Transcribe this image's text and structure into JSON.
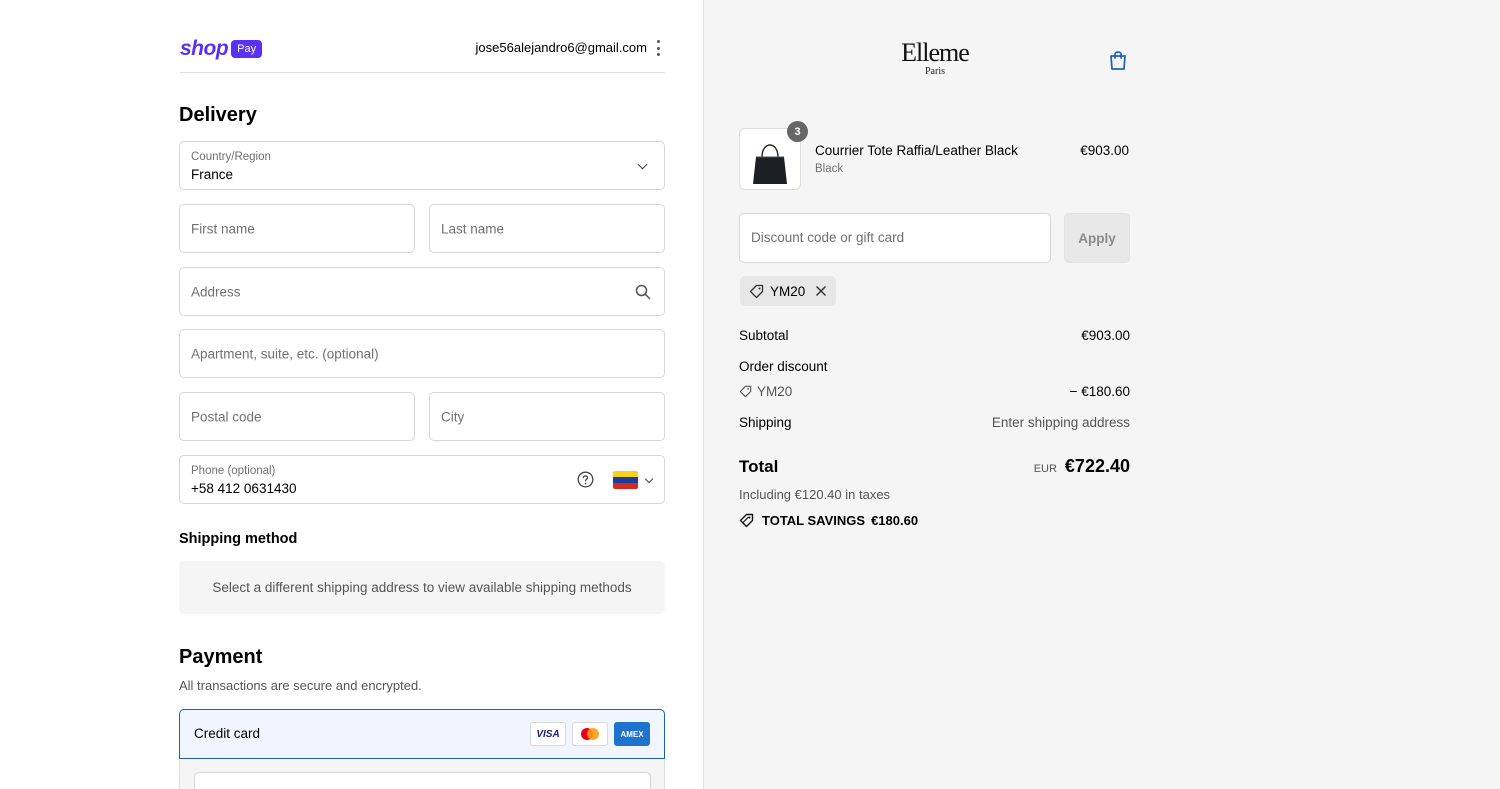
{
  "header": {
    "shop_word": "shop",
    "pay_badge": "Pay",
    "email": "jose56alejandro6@gmail.com"
  },
  "delivery": {
    "title": "Delivery",
    "country_label": "Country/Region",
    "country_value": "France",
    "first_name_placeholder": "First name",
    "last_name_placeholder": "Last name",
    "address_placeholder": "Address",
    "apartment_placeholder": "Apartment, suite, etc. (optional)",
    "postal_placeholder": "Postal code",
    "city_placeholder": "City",
    "phone_label": "Phone (optional)",
    "phone_value": "+58 412 0631430"
  },
  "shipping_method": {
    "title": "Shipping method",
    "message": "Select a different shipping address to view available shipping methods"
  },
  "payment": {
    "title": "Payment",
    "subtitle": "All transactions are secure and encrypted.",
    "credit_card_label": "Credit card",
    "cards": [
      "VISA",
      "mastercard",
      "AMEX"
    ]
  },
  "brand": {
    "name": "Elleme",
    "sub": "Paris"
  },
  "order": {
    "item": {
      "name": "Courrier Tote Raffia/Leather Black",
      "variant": "Black",
      "price": "€903.00",
      "quantity": "3"
    },
    "discount_placeholder": "Discount code or gift card",
    "apply_label": "Apply",
    "applied_code": "YM20",
    "subtotal_label": "Subtotal",
    "subtotal_value": "€903.00",
    "order_discount_label": "Order discount",
    "discount_code": "YM20",
    "discount_value": "− €180.60",
    "shipping_label": "Shipping",
    "shipping_value": "Enter shipping address",
    "total_label": "Total",
    "currency": "EUR",
    "total_value": "€722.40",
    "taxes_text": "Including €120.40 in taxes",
    "savings_label": "TOTAL SAVINGS",
    "savings_value": "€180.60"
  },
  "colors": {
    "shop_purple": "#5a31f4",
    "accent_blue": "#1f5fb7",
    "panel_bg": "#f5f5f5"
  }
}
